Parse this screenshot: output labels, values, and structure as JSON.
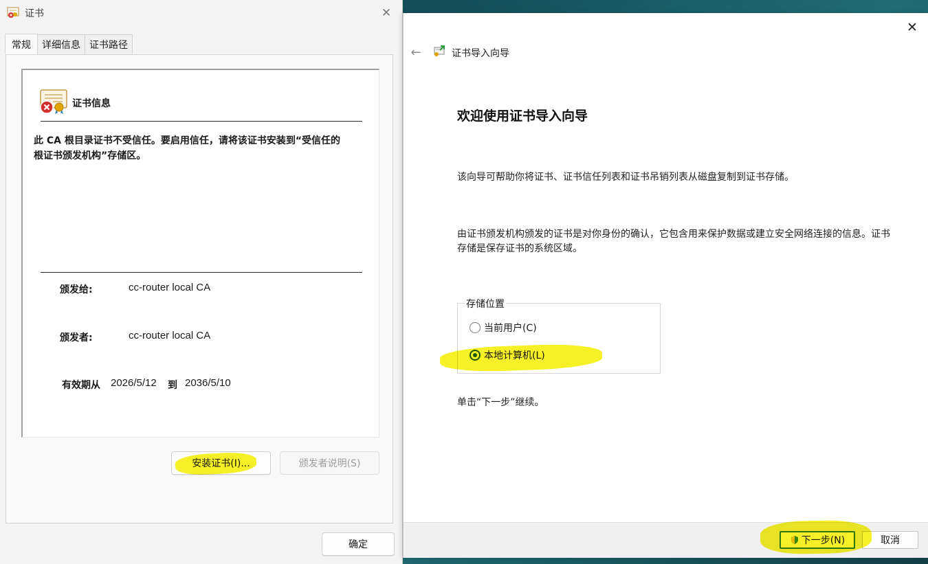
{
  "cert_dialog": {
    "title": "证书",
    "tabs": [
      {
        "label": "常规",
        "active": true
      },
      {
        "label": "详细信息",
        "active": false
      },
      {
        "label": "证书路径",
        "active": false
      }
    ],
    "info_heading": "证书信息",
    "warning": "此 CA 根目录证书不受信任。要启用信任，请将该证书安装到“受信任的根证书颁发机构”存储区。",
    "issued_to_label": "颁发给:",
    "issued_to_value": "cc-router local CA",
    "issued_by_label": "颁发者:",
    "issued_by_value": "cc-router local CA",
    "valid_from_label": "有效期从",
    "valid_from": "2026/5/12",
    "valid_to_label": "到",
    "valid_to": "2036/5/10",
    "install_button": "安装证书(I)...",
    "issuer_statement_button": "颁发者说明(S)",
    "ok_button": "确定"
  },
  "wizard": {
    "title": "证书导入向导",
    "heading": "欢迎使用证书导入向导",
    "para1": "该向导可帮助你将证书、证书信任列表和证书吊销列表从磁盘复制到证书存储。",
    "para2": "由证书颁发机构颁发的证书是对你身份的确认，它包含用来保护数据或建立安全网络连接的信息。证书存储是保存证书的系统区域。",
    "store_location_label": "存储位置",
    "options": [
      {
        "label": "当前用户(C)",
        "checked": false
      },
      {
        "label": "本地计算机(L)",
        "checked": true
      }
    ],
    "continue_hint": "单击“下一步”继续。",
    "next_button": "下一步(N)",
    "cancel_button": "取消"
  },
  "colors": {
    "highlight": "#f5ef00",
    "primary_border": "#2d7a3e"
  }
}
